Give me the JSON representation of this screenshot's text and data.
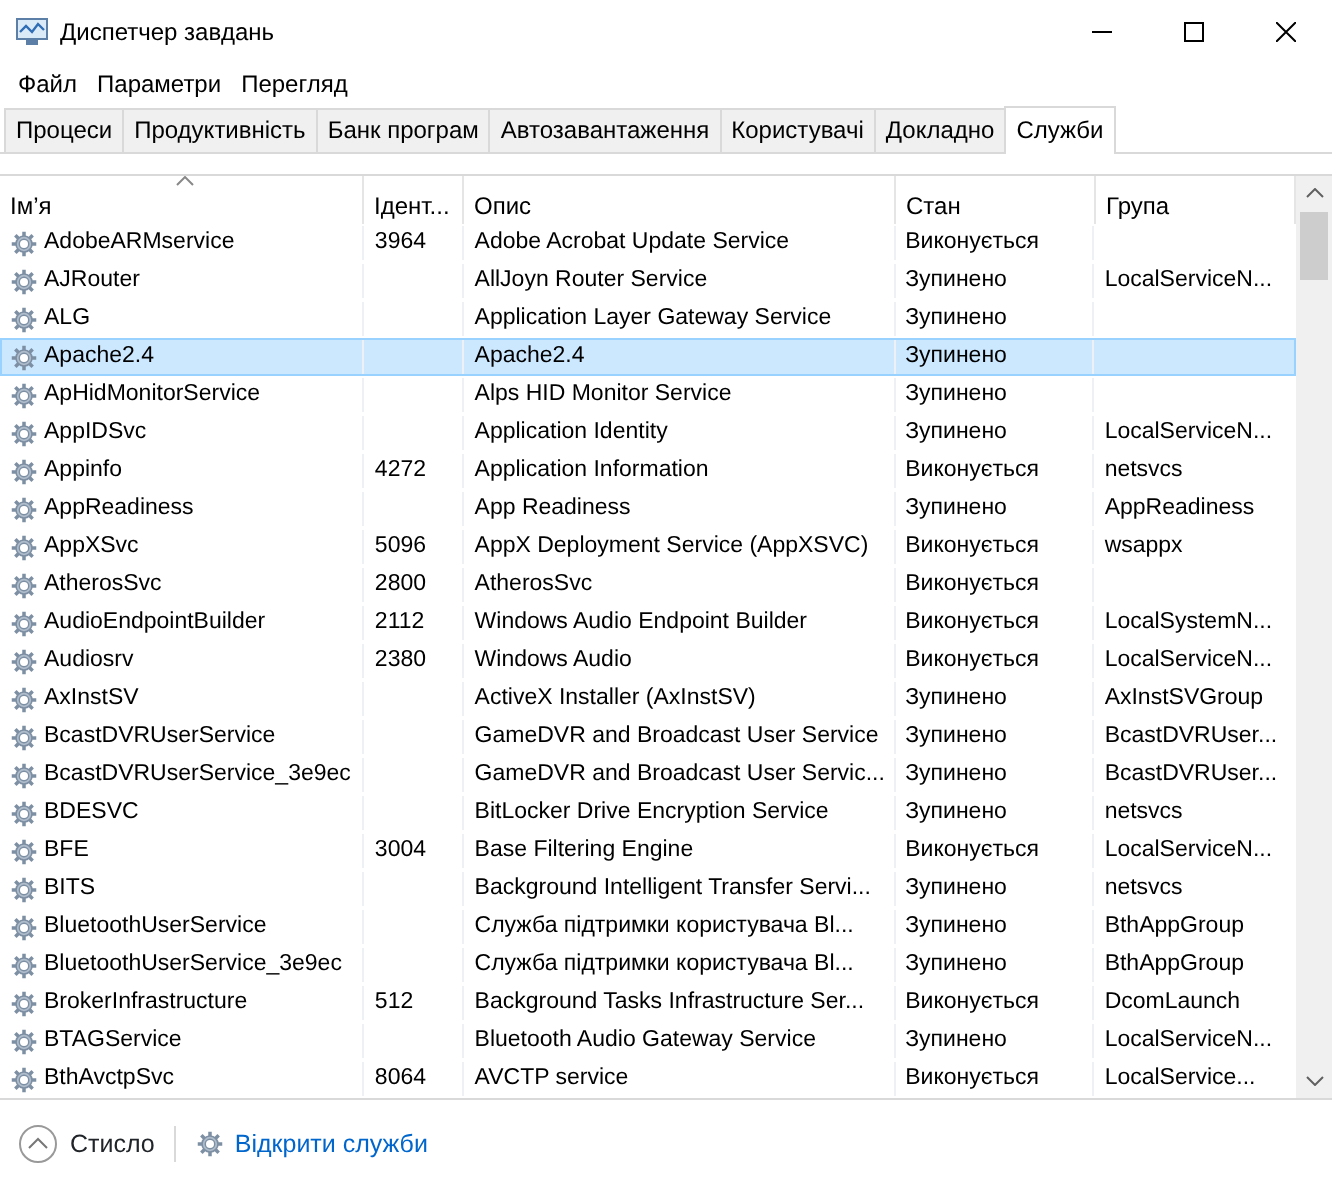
{
  "window": {
    "title": "Диспетчер завдань"
  },
  "menu": [
    {
      "label": "Файл"
    },
    {
      "label": "Параметри"
    },
    {
      "label": "Перегляд"
    }
  ],
  "tabs": [
    {
      "label": "Процеси",
      "selected": false
    },
    {
      "label": "Продуктивність",
      "selected": false
    },
    {
      "label": "Банк програм",
      "selected": false
    },
    {
      "label": "Автозавантаження",
      "selected": false
    },
    {
      "label": "Користувачі",
      "selected": false
    },
    {
      "label": "Докладно",
      "selected": false
    },
    {
      "label": "Служби",
      "selected": true
    }
  ],
  "table": {
    "columns": [
      {
        "label": "Ім’я",
        "sorted": true
      },
      {
        "label": "Ідент...",
        "sorted": false
      },
      {
        "label": "Опис",
        "sorted": false
      },
      {
        "label": "Стан",
        "sorted": false
      },
      {
        "label": "Група",
        "sorted": false
      }
    ],
    "rows": [
      {
        "name": "AdobeARMservice",
        "pid": "3964",
        "description": "Adobe Acrobat Update Service",
        "status": "Виконується",
        "group": "",
        "selected": false
      },
      {
        "name": "AJRouter",
        "pid": "",
        "description": "AllJoyn Router Service",
        "status": "Зупинено",
        "group": "LocalServiceN...",
        "selected": false
      },
      {
        "name": "ALG",
        "pid": "",
        "description": "Application Layer Gateway Service",
        "status": "Зупинено",
        "group": "",
        "selected": false
      },
      {
        "name": "Apache2.4",
        "pid": "",
        "description": "Apache2.4",
        "status": "Зупинено",
        "group": "",
        "selected": true
      },
      {
        "name": "ApHidMonitorService",
        "pid": "",
        "description": "Alps HID Monitor Service",
        "status": "Зупинено",
        "group": "",
        "selected": false
      },
      {
        "name": "AppIDSvc",
        "pid": "",
        "description": "Application Identity",
        "status": "Зупинено",
        "group": "LocalServiceN...",
        "selected": false
      },
      {
        "name": "Appinfo",
        "pid": "4272",
        "description": "Application Information",
        "status": "Виконується",
        "group": "netsvcs",
        "selected": false
      },
      {
        "name": "AppReadiness",
        "pid": "",
        "description": "App Readiness",
        "status": "Зупинено",
        "group": "AppReadiness",
        "selected": false
      },
      {
        "name": "AppXSvc",
        "pid": "5096",
        "description": "AppX Deployment Service (AppXSVC)",
        "status": "Виконується",
        "group": "wsappx",
        "selected": false
      },
      {
        "name": "AtherosSvc",
        "pid": "2800",
        "description": "AtherosSvc",
        "status": "Виконується",
        "group": "",
        "selected": false
      },
      {
        "name": "AudioEndpointBuilder",
        "pid": "2112",
        "description": "Windows Audio Endpoint Builder",
        "status": "Виконується",
        "group": "LocalSystemN...",
        "selected": false
      },
      {
        "name": "Audiosrv",
        "pid": "2380",
        "description": "Windows Audio",
        "status": "Виконується",
        "group": "LocalServiceN...",
        "selected": false
      },
      {
        "name": "AxInstSV",
        "pid": "",
        "description": "ActiveX Installer (AxInstSV)",
        "status": "Зупинено",
        "group": "AxInstSVGroup",
        "selected": false
      },
      {
        "name": "BcastDVRUserService",
        "pid": "",
        "description": "GameDVR and Broadcast User Service",
        "status": "Зупинено",
        "group": "BcastDVRUser...",
        "selected": false
      },
      {
        "name": "BcastDVRUserService_3e9ec",
        "pid": "",
        "description": "GameDVR and Broadcast User Servic...",
        "status": "Зупинено",
        "group": "BcastDVRUser...",
        "selected": false
      },
      {
        "name": "BDESVC",
        "pid": "",
        "description": "BitLocker Drive Encryption Service",
        "status": "Зупинено",
        "group": "netsvcs",
        "selected": false
      },
      {
        "name": "BFE",
        "pid": "3004",
        "description": "Base Filtering Engine",
        "status": "Виконується",
        "group": "LocalServiceN...",
        "selected": false
      },
      {
        "name": "BITS",
        "pid": "",
        "description": "Background Intelligent Transfer Servi...",
        "status": "Зупинено",
        "group": "netsvcs",
        "selected": false
      },
      {
        "name": "BluetoothUserService",
        "pid": "",
        "description": "Служба підтримки користувача Bl...",
        "status": "Зупинено",
        "group": "BthAppGroup",
        "selected": false
      },
      {
        "name": "BluetoothUserService_3e9ec",
        "pid": "",
        "description": "Служба підтримки користувача Bl...",
        "status": "Зупинено",
        "group": "BthAppGroup",
        "selected": false
      },
      {
        "name": "BrokerInfrastructure",
        "pid": "512",
        "description": "Background Tasks Infrastructure Ser...",
        "status": "Виконується",
        "group": "DcomLaunch",
        "selected": false
      },
      {
        "name": "BTAGService",
        "pid": "",
        "description": "Bluetooth Audio Gateway Service",
        "status": "Зупинено",
        "group": "LocalServiceN...",
        "selected": false
      },
      {
        "name": "BthAvctpSvc",
        "pid": "8064",
        "description": "AVCTP service",
        "status": "Виконується",
        "group": "LocalService...",
        "selected": false
      }
    ]
  },
  "footer": {
    "collapse_label": "Стисло",
    "link": "Відкрити служби"
  }
}
